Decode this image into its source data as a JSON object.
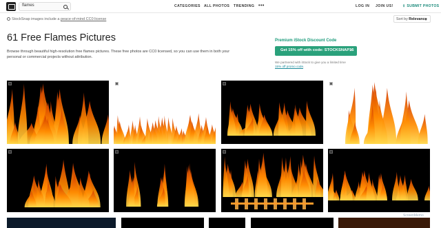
{
  "nav": {
    "search_value": "flames",
    "links": [
      "CATEGORIES",
      "ALL PHOTOS",
      "TRENDING"
    ],
    "more": "•••",
    "login": "LOG IN",
    "join": "JOIN US!",
    "submit": "SUBMIT PHOTOS"
  },
  "license": {
    "prefix": "StockSnap images include a ",
    "link": "peace-of-mind CC0 license"
  },
  "sort": {
    "label": "Sort by",
    "value": "Relevance"
  },
  "header": {
    "title": "61 Free Flames Pictures",
    "description": "Browse through beautiful high-resolution free flames pictures. These free photos are CC0 licensed, so you can use them in both your personal or commercial projects without attribution."
  },
  "promo": {
    "title": "Premium iStock Discount Code",
    "button": "Get 15% off with code: STOCKSNAP15",
    "note_prefix": "We partnered with iStock to give you a limited time ",
    "note_link": "15% off promo code",
    "note_suffix": "."
  },
  "photos": [
    {
      "style": "dark",
      "variant": "wall"
    },
    {
      "style": "light",
      "variant": "ridge"
    },
    {
      "style": "dark",
      "variant": "waves"
    },
    {
      "style": "light",
      "variant": "tall"
    },
    {
      "style": "dark",
      "variant": "bonfire"
    },
    {
      "style": "dark",
      "variant": "three"
    },
    {
      "style": "dark",
      "variant": "grill"
    },
    {
      "style": "dark",
      "variant": "line"
    }
  ],
  "watermark": "ScreenMemo",
  "colors": {
    "accent": "#2aa17b",
    "flame_core": "#ffd84a",
    "flame_mid": "#ff8a00",
    "flame_edge": "#d23a00"
  }
}
